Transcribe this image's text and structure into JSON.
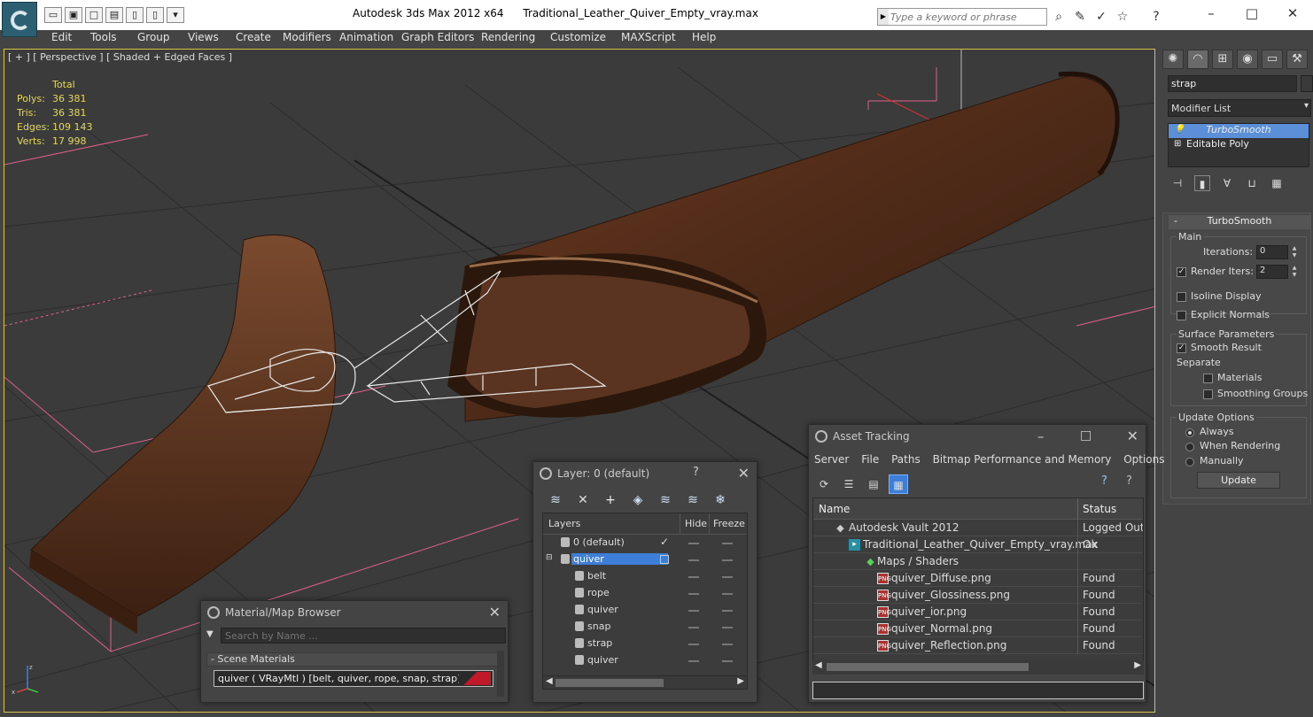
{
  "title": {
    "app": "Autodesk 3ds Max  2012 x64",
    "file": "Traditional_Leather_Quiver_Empty_vray.max"
  },
  "search": {
    "placeholder": "Type a keyword or phrase"
  },
  "menu": [
    "Edit",
    "Tools",
    "Group",
    "Views",
    "Create",
    "Modifiers",
    "Animation",
    "Graph Editors",
    "Rendering",
    "Customize",
    "MAXScript",
    "Help"
  ],
  "viewport": {
    "label": "[ + ] [ Perspective ] [ Shaded + Edged Faces ]",
    "stats": {
      "header": "Total",
      "rows": [
        {
          "k": "Polys:",
          "v": "36 381"
        },
        {
          "k": "Tris:",
          "v": "36 381"
        },
        {
          "k": "Edges:",
          "v": "109 143"
        },
        {
          "k": "Verts:",
          "v": "17 998"
        }
      ]
    },
    "colors": {
      "stats": "#e5d85a",
      "border": "#d5c34a"
    }
  },
  "command_panel": {
    "object_name": "strap",
    "modifier_list": "Modifier List",
    "stack": [
      "TurboSmooth",
      "Editable Poly"
    ],
    "rollout_title": "TurboSmooth",
    "main": {
      "group": "Main",
      "iterations_label": "Iterations:",
      "iterations": "0",
      "render_iters_label": "Render Iters:",
      "render_iters": "2",
      "isoline": "Isoline Display",
      "explicit": "Explicit Normals"
    },
    "surface": {
      "group": "Surface Parameters",
      "smooth": "Smooth Result",
      "separate": "Separate",
      "materials": "Materials",
      "smoothing_groups": "Smoothing Groups"
    },
    "update": {
      "group": "Update Options",
      "always": "Always",
      "when_rendering": "When Rendering",
      "manually": "Manually",
      "button": "Update"
    }
  },
  "material_browser": {
    "title": "Material/Map Browser",
    "search_placeholder": "Search by Name ...",
    "section": "- Scene Materials",
    "item": "quiver  ( VRayMtl )  [belt, quiver, rope, snap, strap]"
  },
  "layer_dialog": {
    "title": "Layer: 0 (default)",
    "help": "?",
    "columns": {
      "layers": "Layers",
      "hide": "Hide",
      "freeze": "Freeze"
    },
    "rows": [
      {
        "name": "0 (default)"
      },
      {
        "name": "quiver"
      },
      {
        "name": "belt"
      },
      {
        "name": "rope"
      },
      {
        "name": "quiver"
      },
      {
        "name": "snap"
      },
      {
        "name": "strap"
      },
      {
        "name": "quiver"
      }
    ]
  },
  "asset_tracking": {
    "title": "Asset Tracking",
    "menu": [
      "Server",
      "File",
      "Paths",
      "Bitmap Performance and Memory",
      "Options"
    ],
    "columns": {
      "name": "Name",
      "status": "Status"
    },
    "rows": [
      {
        "name": "Autodesk Vault 2012",
        "status": "Logged Out ..."
      },
      {
        "name": "Traditional_Leather_Quiver_Empty_vray.max",
        "status": "Ok"
      },
      {
        "name": "Maps / Shaders",
        "status": ""
      },
      {
        "name": "quiver_Diffuse.png",
        "status": "Found"
      },
      {
        "name": "quiver_Glossiness.png",
        "status": "Found"
      },
      {
        "name": "quiver_ior.png",
        "status": "Found"
      },
      {
        "name": "quiver_Normal.png",
        "status": "Found"
      },
      {
        "name": "quiver_Reflection.png",
        "status": "Found"
      }
    ],
    "png_badge": "PNG"
  }
}
